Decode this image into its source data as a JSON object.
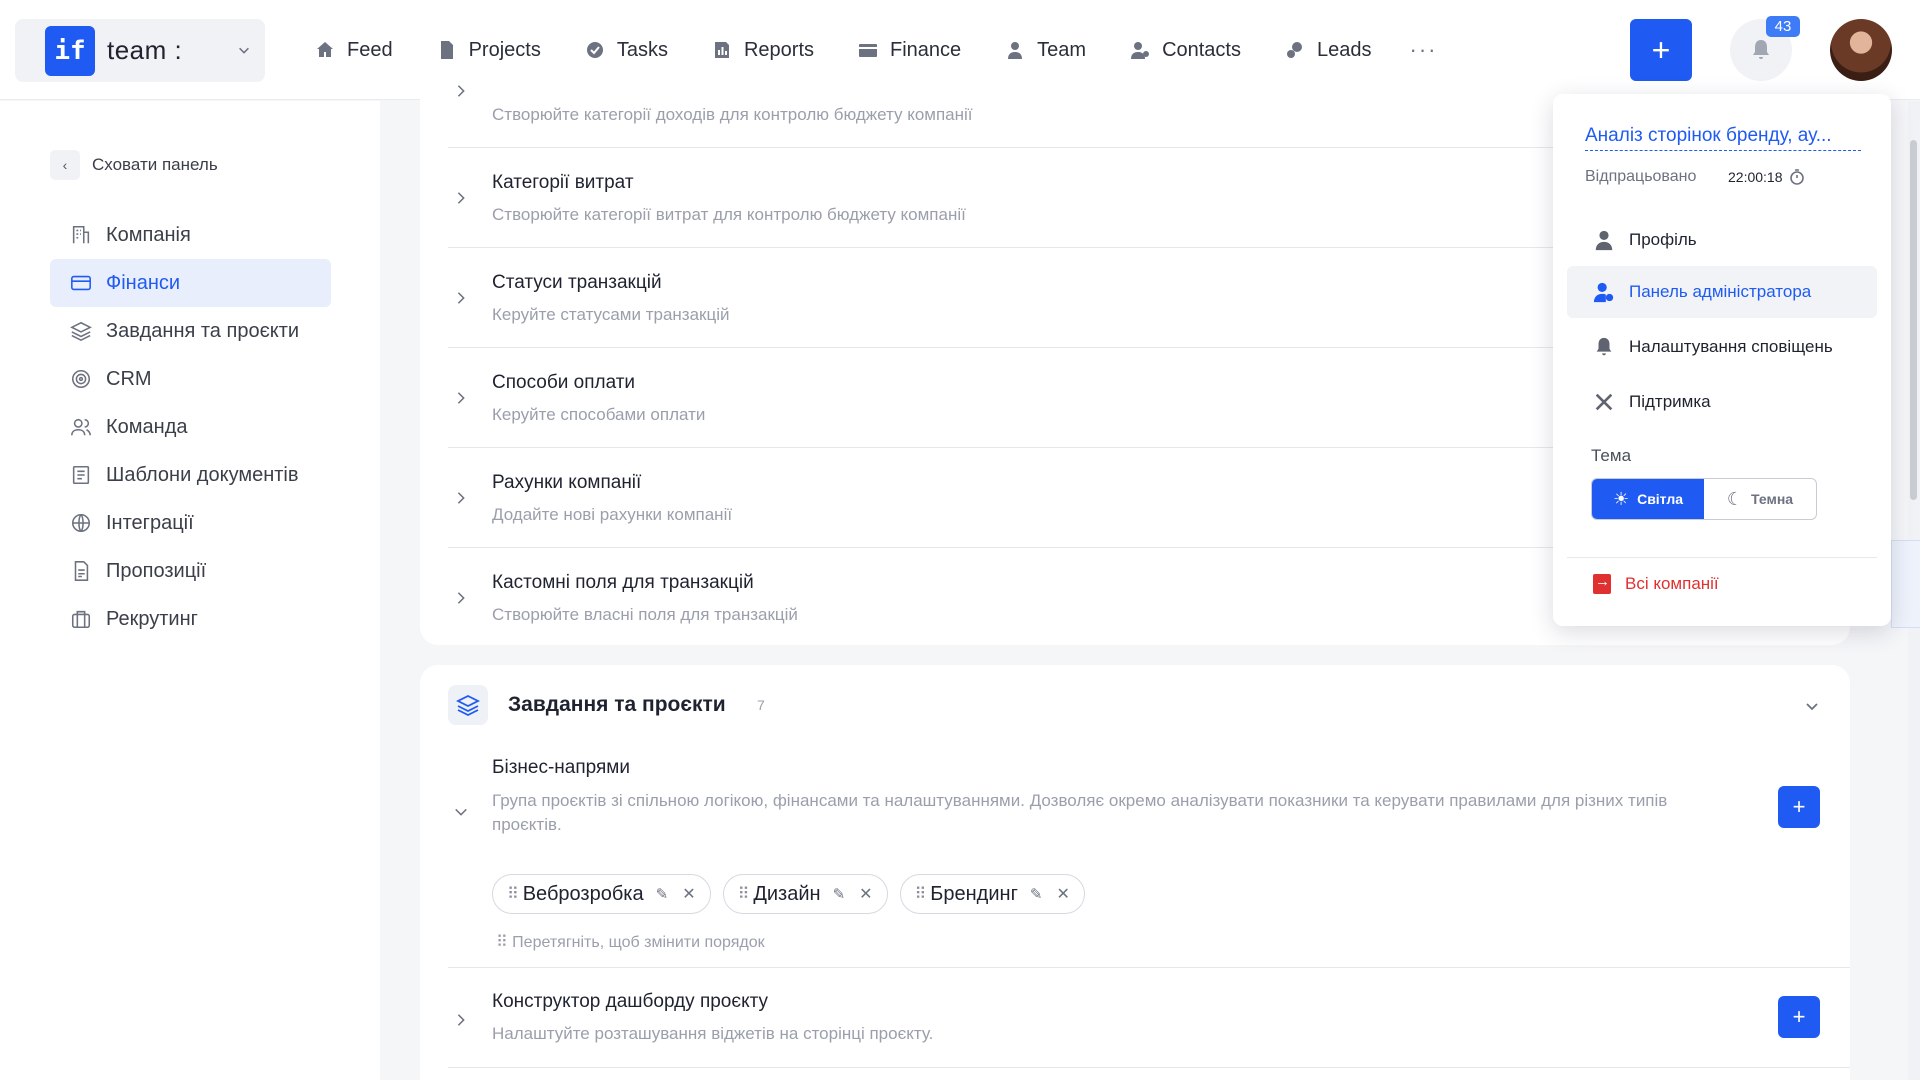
{
  "topbar": {
    "team_logo": "if",
    "team_name": "team :",
    "nav": [
      {
        "label": "Feed",
        "icon": "home-icon"
      },
      {
        "label": "Projects",
        "icon": "file-icon"
      },
      {
        "label": "Tasks",
        "icon": "check-circle-icon"
      },
      {
        "label": "Reports",
        "icon": "report-icon"
      },
      {
        "label": "Finance",
        "icon": "wallet-icon"
      },
      {
        "label": "Team",
        "icon": "user-icon"
      },
      {
        "label": "Contacts",
        "icon": "contacts-icon"
      },
      {
        "label": "Leads",
        "icon": "leads-icon"
      }
    ],
    "more": "···",
    "add": "+",
    "notifications_count": "43"
  },
  "sidebar": {
    "hide_panel": "Сховати панель",
    "items": [
      {
        "label": "Компанія",
        "icon": "company-icon"
      },
      {
        "label": "Фінанси",
        "icon": "card-icon",
        "active": true
      },
      {
        "label": "Завдання та проєкти",
        "icon": "layers-icon"
      },
      {
        "label": "CRM",
        "icon": "target-icon"
      },
      {
        "label": "Команда",
        "icon": "users-icon"
      },
      {
        "label": "Шаблони документів",
        "icon": "document-icon"
      },
      {
        "label": "Інтеграції",
        "icon": "globe-icon"
      },
      {
        "label": "Пропозиції",
        "icon": "proposal-icon"
      },
      {
        "label": "Рекрутинг",
        "icon": "briefcase-icon"
      }
    ]
  },
  "finance_rows": [
    {
      "title": "",
      "desc": "Створюйте категорії доходів для контролю бюджету компанії"
    },
    {
      "title": "Категорії витрат",
      "desc": "Створюйте категорії витрат для контролю бюджету компанії"
    },
    {
      "title": "Статуси транзакцій",
      "desc": "Керуйте статусами транзакцій"
    },
    {
      "title": "Способи оплати",
      "desc": "Керуйте способами оплати"
    },
    {
      "title": "Рахунки компанії",
      "desc": "Додайте нові рахунки компанії"
    },
    {
      "title": "Кастомні поля для транзакцій",
      "desc": "Створюйте власні поля для транзакцій"
    }
  ],
  "tasks_section": {
    "title": "Завдання та проєкти",
    "count": "7",
    "business": {
      "title": "Бізнес-напрями",
      "desc_line1": "Група проєктів зі спільною логікою, фінансами та налаштуваннями. Дозволяє окремо аналізувати показники та керувати правилами для різних типів",
      "desc_line2": "проєктів.",
      "chips": [
        "Веброзробка",
        "Дизайн",
        "Брендинг"
      ],
      "drag_hint": "Перетягніть, щоб змінити порядок"
    },
    "dashboard": {
      "title": "Конструктор дашборду проєкту",
      "desc": "Налаштуйте розташування віджетів на сторінці проєкту."
    }
  },
  "dropdown": {
    "task_link": "Аналіз сторінок бренду, ау...",
    "worked_label": "Відпрацьовано",
    "worked_time": "22:00:18",
    "items": [
      {
        "label": "Профіль",
        "icon": "user-icon"
      },
      {
        "label": "Панель адміністратора",
        "icon": "user-gear-icon",
        "active": true
      },
      {
        "label": "Налаштування сповіщень",
        "icon": "bell-icon"
      },
      {
        "label": "Підтримка",
        "icon": "tools-icon"
      }
    ],
    "theme_label": "Тема",
    "theme_light": "Світла",
    "theme_dark": "Темна",
    "all_companies": "Всі компанії"
  },
  "colors": {
    "accent": "#1f5bf2",
    "danger": "#e03131"
  }
}
